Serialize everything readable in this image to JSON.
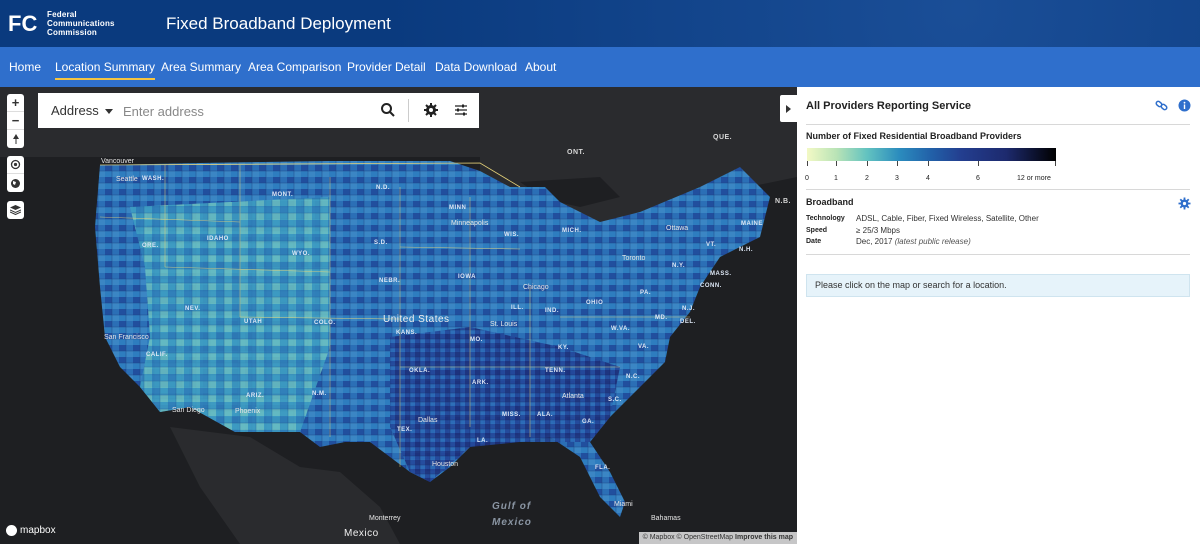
{
  "header": {
    "agency_lines": [
      "Federal",
      "Communications",
      "Commission"
    ],
    "app_title": "Fixed Broadband Deployment",
    "colors": {
      "header_bg": "#0a3a7e",
      "nav_bg": "#2f6fcc",
      "active_underline": "#f5c542"
    }
  },
  "nav": {
    "items": [
      {
        "label": "Home",
        "active": false
      },
      {
        "label": "Location Summary",
        "active": true
      },
      {
        "label": "Area Summary",
        "active": false
      },
      {
        "label": "Area Comparison",
        "active": false
      },
      {
        "label": "Provider Detail",
        "active": false
      },
      {
        "label": "Data Download",
        "active": false
      },
      {
        "label": "About",
        "active": false
      }
    ]
  },
  "map": {
    "search": {
      "selector_label": "Address",
      "placeholder": "Enter address",
      "icons": [
        "search-icon",
        "gear-icon",
        "sliders-icon"
      ]
    },
    "controls": [
      "zoom-in-icon",
      "zoom-out-icon",
      "compass-icon",
      "locate-icon",
      "globe-icon",
      "layers-icon"
    ],
    "labels": {
      "ont": "ONT.",
      "que": "QUE.",
      "nb": "N.B.",
      "wash": "WASH.",
      "mont": "MONT.",
      "nd": "N.D.",
      "minn": "MINN",
      "ore": "ORE.",
      "idaho": "IDAHO",
      "wyo": "WYO.",
      "sd": "S.D.",
      "wis": "WIS.",
      "mich": "MICH.",
      "maine": "MAINE",
      "vt": "VT.",
      "nh": "N.H.",
      "ny": "N.Y.",
      "mass": "MASS.",
      "conn": "CONN.",
      "nev": "NEV.",
      "utah": "UTAH",
      "colo": "COLO.",
      "nebr": "NEBR.",
      "iowa": "IOWA",
      "ill": "ILL.",
      "ind": "IND.",
      "ohio": "OHIO",
      "pa": "PA.",
      "nj": "N.J.",
      "md": "MD.",
      "del": "DEL.",
      "wva": "W.VA.",
      "va": "VA.",
      "kans": "KANS.",
      "mo": "MO.",
      "ky": "KY.",
      "calif": "CALIF.",
      "ariz": "ARIZ.",
      "nm": "N.M.",
      "okla": "OKLA.",
      "ark": "ARK.",
      "tenn": "TENN.",
      "nc": "N.C.",
      "sc": "S.C.",
      "miss": "MISS.",
      "ala": "ALA.",
      "ga": "GA.",
      "la": "LA.",
      "tex": "TEX.",
      "fla": "FLA."
    },
    "cities": {
      "vancouver": "Vancouver",
      "seattle": "Seattle",
      "minneapolis": "Minneapolis",
      "ottawa": "Ottawa",
      "toronto": "Toronto",
      "chicago": "Chicago",
      "sf": "San Francisco",
      "st_louis": "St. Louis",
      "sd": "San Diego",
      "phoenix": "Phoenix",
      "dallas": "Dallas",
      "atlanta": "Atlanta",
      "houston": "Houston",
      "miami": "Miami",
      "monterrey": "Monterrey",
      "bahamas": "Bahamas"
    },
    "country_label": "United States",
    "mexico_label": "Mexico",
    "gulf_label": [
      "Gulf of",
      "Mexico"
    ],
    "mapbox_label": "mapbox",
    "attribution": {
      "text": "© Mapbox © OpenStreetMap",
      "link": "Improve this map"
    }
  },
  "panel": {
    "title": "All Providers Reporting Service",
    "legend_title": "Number of Fixed Residential Broadband Providers",
    "legend_ticks": [
      "0",
      "1",
      "2",
      "3",
      "4",
      "6",
      "12 or more"
    ],
    "section_title": "Broadband",
    "technology_key": "Technology",
    "technology_val": "ADSL, Cable, Fiber, Fixed Wireless, Satellite, Other",
    "speed_key": "Speed",
    "speed_val": "≥ 25/3 Mbps",
    "date_key": "Date",
    "date_val": "Dec, 2017",
    "date_note": "(latest public release)",
    "notice": "Please click on the map or search for a location."
  }
}
